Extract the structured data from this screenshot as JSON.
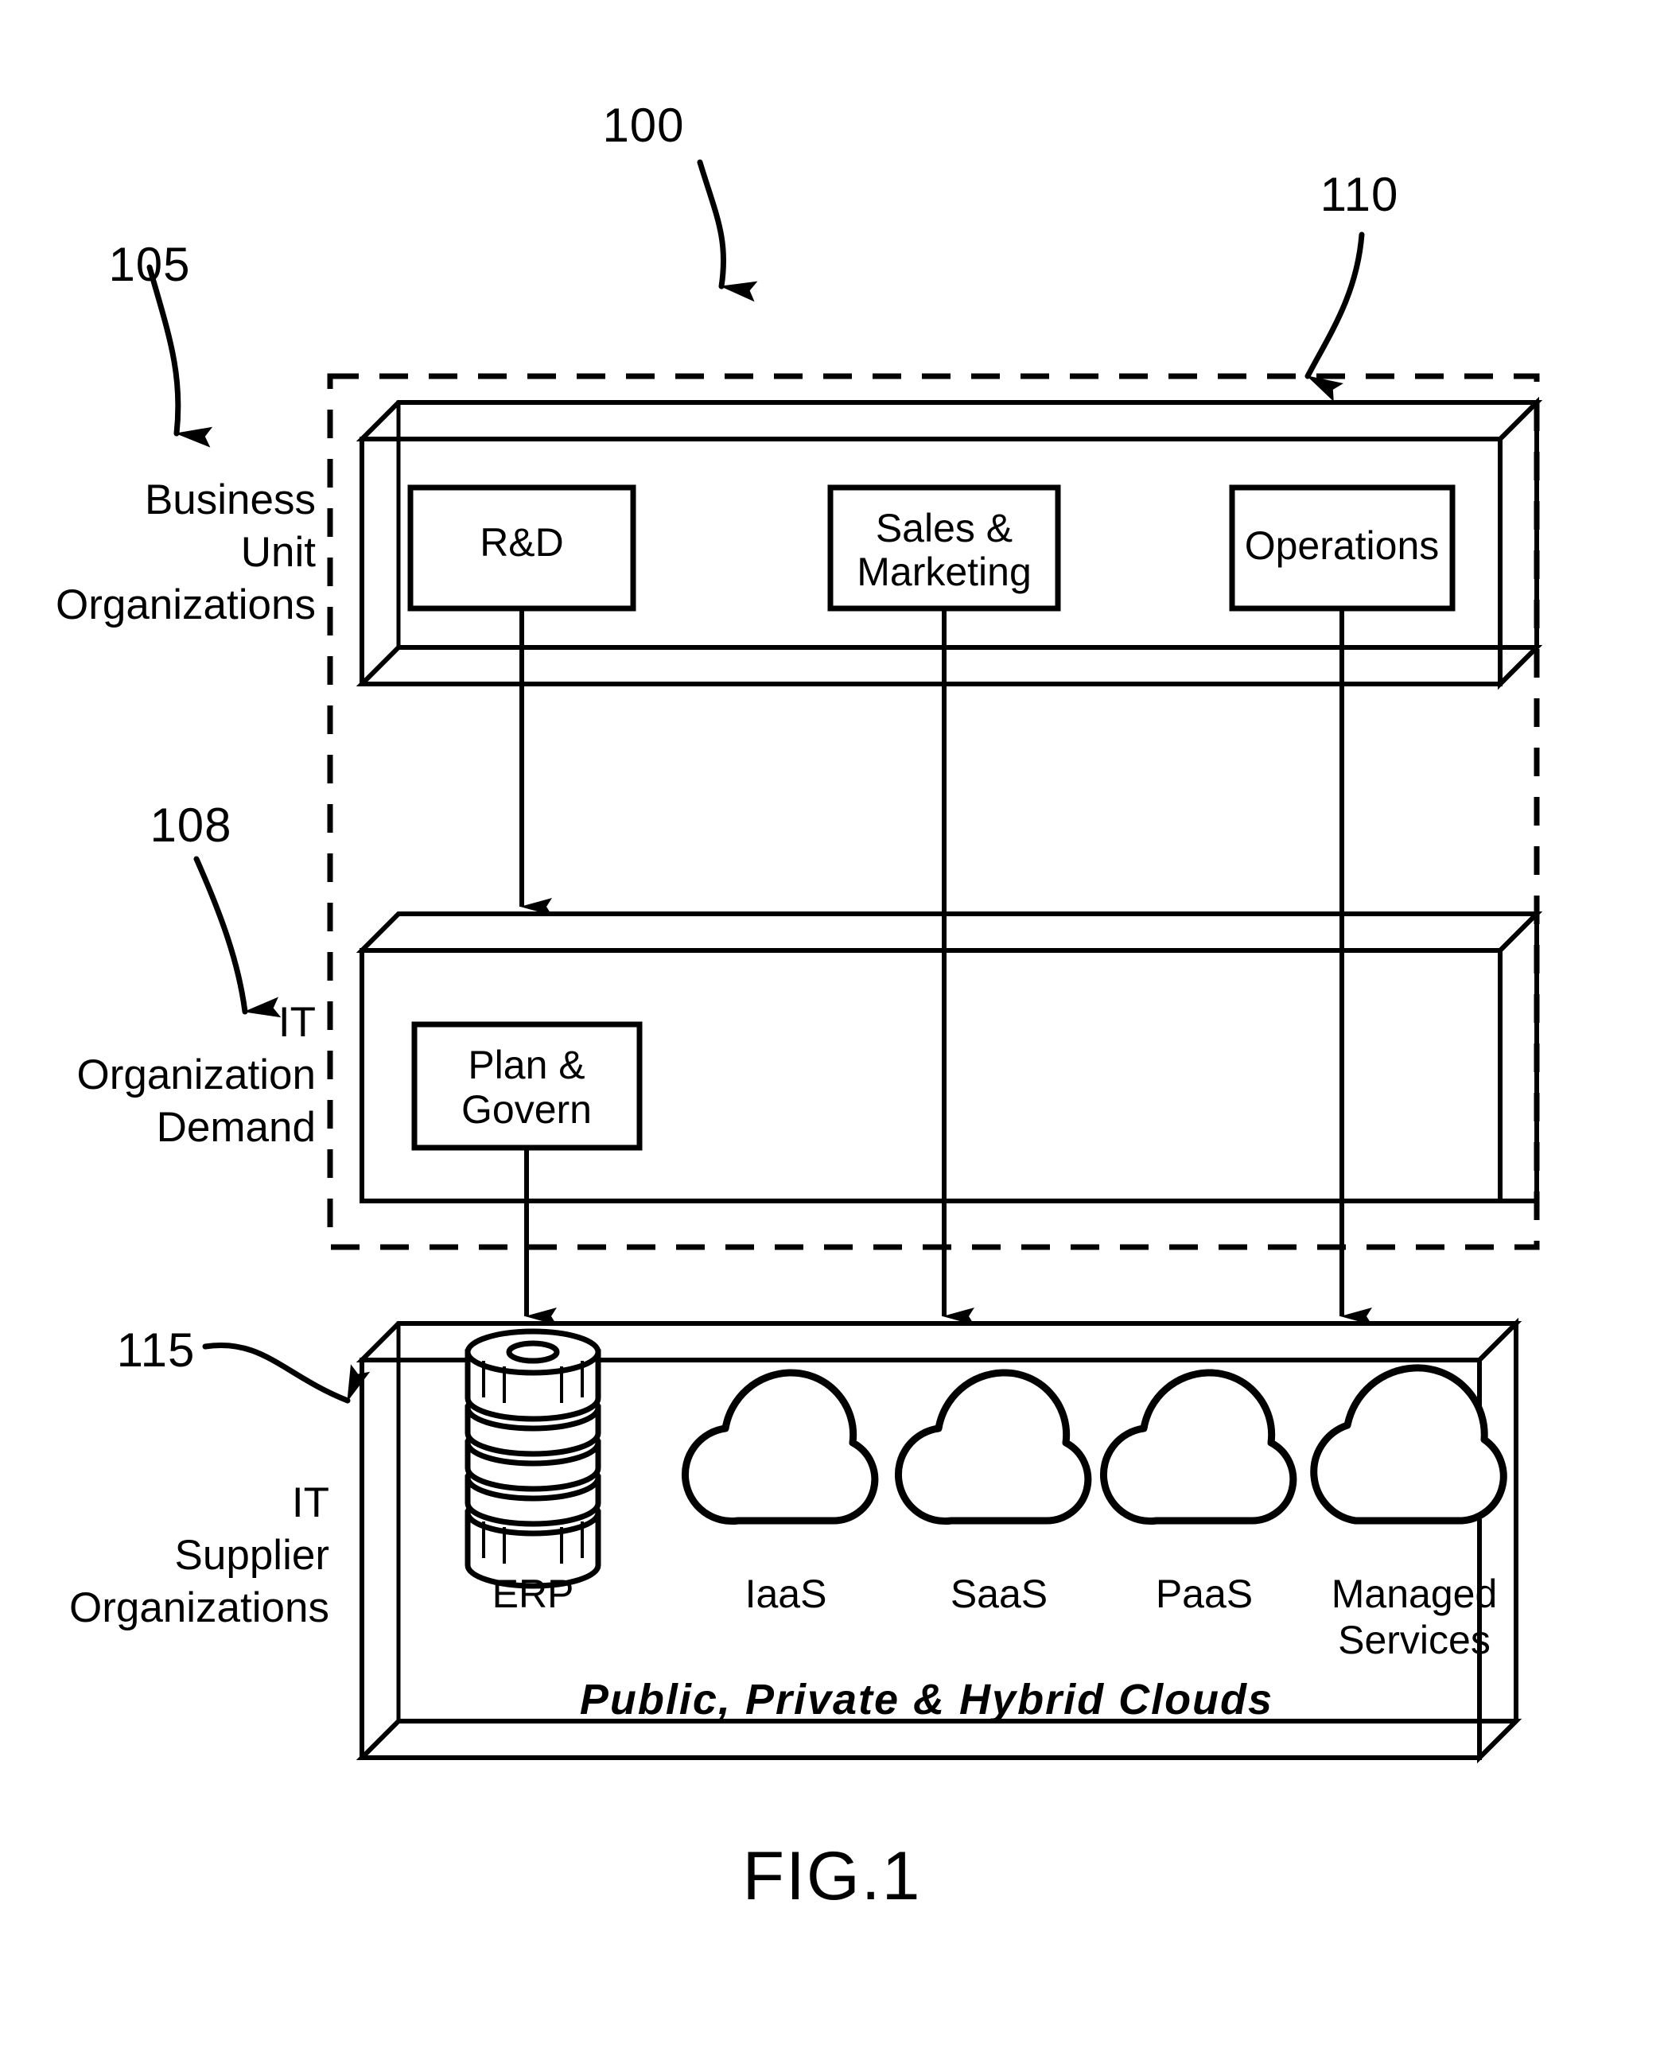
{
  "figure": {
    "caption": "FIG.1",
    "reference_numerals": {
      "system": "100",
      "business_unit": "105",
      "it_organization": "108",
      "enterprise_boundary": "110",
      "it_supplier": "115"
    }
  },
  "tiers": [
    {
      "id": "business-unit",
      "ref": "105",
      "label_lines": [
        "Business",
        "Unit",
        "Organizations"
      ],
      "nodes": [
        {
          "id": "rnd",
          "label_lines": [
            "R&D"
          ]
        },
        {
          "id": "sales-marketing",
          "label_lines": [
            "Sales  &",
            "Marketing"
          ]
        },
        {
          "id": "operations",
          "label_lines": [
            "Operations"
          ]
        }
      ]
    },
    {
      "id": "it-organization",
      "ref": "108",
      "label_lines": [
        "IT",
        "Organization",
        "Demand"
      ],
      "nodes": [
        {
          "id": "plan-govern",
          "label_lines": [
            "Plan  &",
            "Govern"
          ]
        }
      ]
    },
    {
      "id": "it-supplier",
      "ref": "115",
      "label_lines": [
        "IT",
        "Supplier",
        "Organizations"
      ],
      "caption": "Public,  Private  &  Hybrid  Clouds",
      "services": [
        {
          "id": "erp",
          "icon": "database-cylinder-icon",
          "label_lines": [
            "ERP"
          ]
        },
        {
          "id": "iaas",
          "icon": "cloud-icon",
          "label_lines": [
            "IaaS"
          ]
        },
        {
          "id": "saas",
          "icon": "cloud-icon",
          "label_lines": [
            "SaaS"
          ]
        },
        {
          "id": "paas",
          "icon": "cloud-icon",
          "label_lines": [
            "PaaS"
          ]
        },
        {
          "id": "managed-services",
          "icon": "cloud-icon",
          "label_lines": [
            "Managed",
            "Services"
          ]
        }
      ]
    }
  ],
  "colors": {
    "ink": "#000000",
    "paper": "#ffffff"
  }
}
